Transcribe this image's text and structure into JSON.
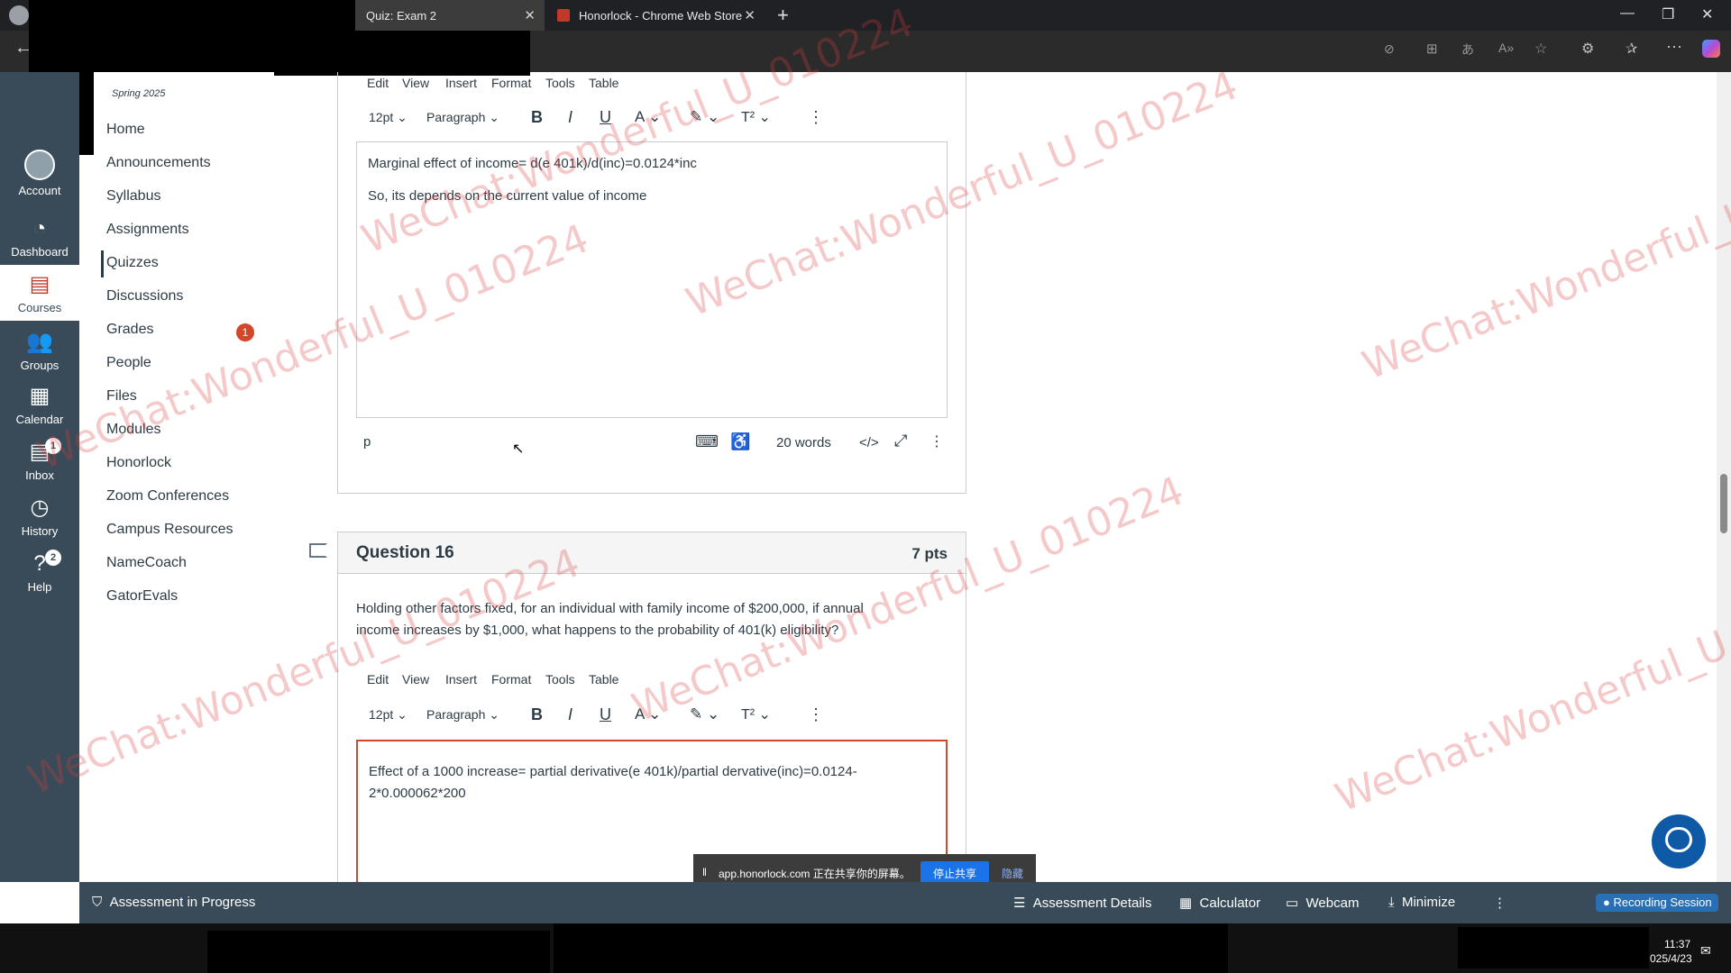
{
  "browser": {
    "tabs": [
      {
        "title": "Quiz: Exam 2",
        "close": "✕"
      },
      {
        "title": "Honorlock - Chrome Web Store",
        "close": "✕"
      }
    ],
    "new_tab": "+",
    "window_controls": {
      "minimize": "—",
      "restore": "❐",
      "close": "✕"
    }
  },
  "global_nav": {
    "items": [
      {
        "label": "Account",
        "icon": "avatar-icon"
      },
      {
        "label": "Dashboard",
        "icon": "dashboard-icon"
      },
      {
        "label": "Courses",
        "icon": "courses-icon"
      },
      {
        "label": "Groups",
        "icon": "groups-icon"
      },
      {
        "label": "Calendar",
        "icon": "calendar-icon"
      },
      {
        "label": "Inbox",
        "icon": "inbox-icon",
        "badge": "1"
      },
      {
        "label": "History",
        "icon": "history-icon"
      },
      {
        "label": "Help",
        "icon": "help-icon",
        "badge": "2"
      }
    ],
    "collapse": "|←"
  },
  "course_nav": {
    "term": "Spring 2025",
    "links": [
      "Home",
      "Announcements",
      "Syllabus",
      "Assignments",
      "Quizzes",
      "Discussions",
      "Grades",
      "People",
      "Files",
      "Modules",
      "Honorlock",
      "Zoom Conferences",
      "Campus Resources",
      "NameCoach",
      "GatorEvals"
    ],
    "grades_badge": "1",
    "active": "Quizzes"
  },
  "editor_menu": [
    "Edit",
    "View",
    "Insert",
    "Format",
    "Tools",
    "Table"
  ],
  "editor_toolbar": {
    "font_size": "12pt",
    "block": "Paragraph",
    "bold": "B",
    "italic": "I",
    "underline": "U",
    "text_color": "A",
    "superscript": "T²",
    "more": "⋮"
  },
  "answer15": {
    "lines": [
      "Marginal effect of income= d(e 401k)/d(inc)=0.0124*inc",
      "So, its depends on the current value of income"
    ],
    "status_tag": "p",
    "word_count": "20 words",
    "code": "</>"
  },
  "question16": {
    "title": "Question 16",
    "points": "7 pts",
    "prompt_line1": "Holding other factors fixed, for an individual with family income of $200,000, if annual",
    "prompt_line2": "income increases by $1,000, what happens to the probability of 401(k) eligibility?",
    "answer_line1": "Effect of a 1000 increase= partial derivative(e 401k)/partial dervative(inc)=0.0124-",
    "answer_line2": "2*0.000062*200"
  },
  "share_bar": {
    "text": "app.honorlock.com 正在共享你的屏幕。",
    "stop": "停止共享",
    "hide": "隐藏"
  },
  "honorlock_bar": {
    "status": "Assessment in Progress",
    "details": "Assessment Details",
    "calculator": "Calculator",
    "webcam": "Webcam",
    "minimize": "Minimize",
    "more": "⋮",
    "recording": "Recording Session"
  },
  "taskbar": {
    "time": "11:37",
    "date": "025/4/23"
  },
  "watermark": "WeChat:Wonderful_U_010224"
}
